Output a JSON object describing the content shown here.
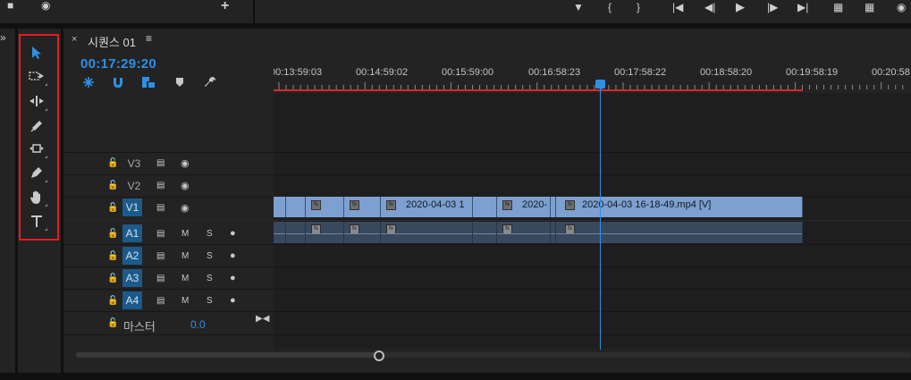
{
  "colors": {
    "accent": "#2f8fe6",
    "highlight_frame": "#e51b23",
    "video_clip": "#7da0d0",
    "audio_clip": "#38495e",
    "track_on": "#1c5a8a"
  },
  "top_controls": {
    "icons": [
      "add-marker-icon",
      "mark-in-icon",
      "mark-out-icon",
      "go-to-in-icon",
      "step-back-icon",
      "play-icon",
      "step-forward-icon",
      "go-to-out-icon",
      "lift-icon",
      "extract-icon",
      "export-frame-icon"
    ],
    "plus": "+"
  },
  "tools": [
    {
      "name": "selection-tool",
      "icon": "arrow-icon"
    },
    {
      "name": "track-select-forward-tool",
      "icon": "track-select-icon"
    },
    {
      "name": "ripple-edit-tool",
      "icon": "ripple-edit-icon"
    },
    {
      "name": "razor-tool",
      "icon": "razor-icon"
    },
    {
      "name": "slip-tool",
      "icon": "slip-icon"
    },
    {
      "name": "pen-tool",
      "icon": "pen-icon"
    },
    {
      "name": "hand-tool",
      "icon": "hand-icon"
    },
    {
      "name": "type-tool",
      "icon": "type-icon"
    }
  ],
  "timeline": {
    "close": "×",
    "title": "시퀀스 01",
    "menu": "≡",
    "timecode": "00:17:29:20",
    "ruler_labels": [
      "00:13:59:03",
      "00:14:59:02",
      "00:15:59:00",
      "00:16:58:23",
      "00:17:58:22",
      "00:18:58:20",
      "00:19:58:19",
      "00:20:58"
    ],
    "video_tracks": [
      {
        "label": "V3",
        "on": false
      },
      {
        "label": "V2",
        "on": false
      },
      {
        "label": "V1",
        "on": true
      }
    ],
    "audio_tracks": [
      {
        "label": "A1",
        "m": "M",
        "s": "S"
      },
      {
        "label": "A2",
        "m": "M",
        "s": "S"
      },
      {
        "label": "A3",
        "m": "M",
        "s": "S"
      },
      {
        "label": "A4",
        "m": "M",
        "s": "S"
      }
    ],
    "master_label": "마스터",
    "master_value": "0.0",
    "video_clips": [
      {
        "name": ""
      },
      {
        "name": ""
      },
      {
        "name": ""
      },
      {
        "name": "2020-04-03 1"
      },
      {
        "name": "2020-"
      },
      {
        "name": ""
      },
      {
        "name": "2020-04-03 16-18-49.mp4 [V]"
      }
    ]
  }
}
